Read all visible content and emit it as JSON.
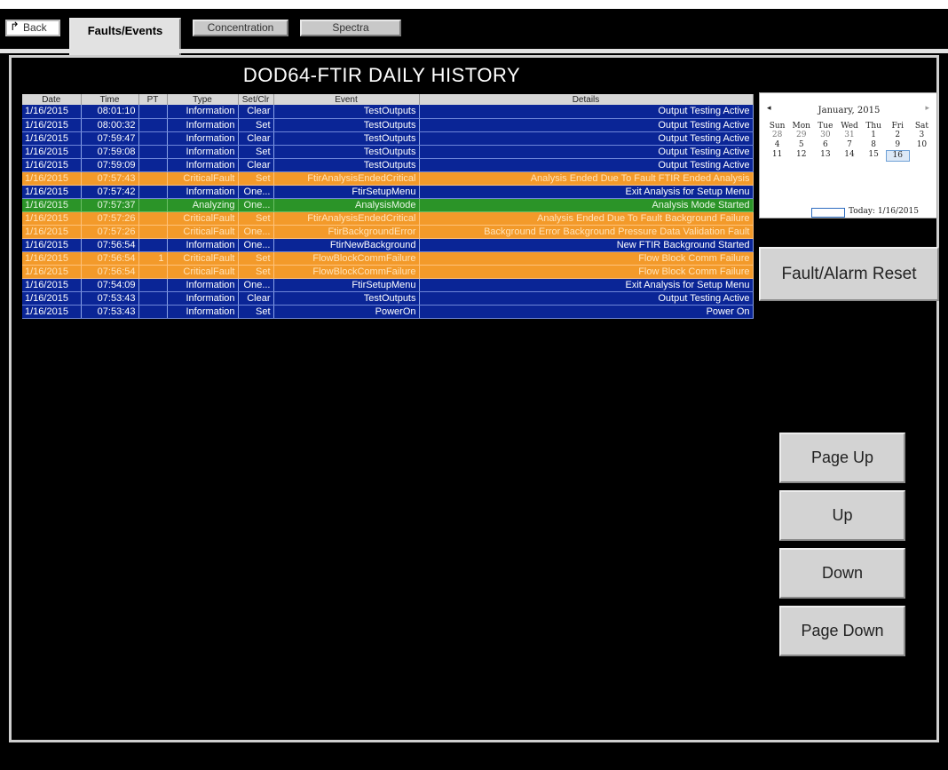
{
  "tabs": {
    "back": "Back",
    "faults": "Faults/Events",
    "concentration": "Concentration",
    "spectra": "Spectra"
  },
  "title": "DOD64-FTIR   DAILY HISTORY",
  "table": {
    "columns": [
      "Date",
      "Time",
      "PT",
      "Type",
      "Set/Clr",
      "Event",
      "Details"
    ],
    "rows": [
      {
        "kind": "info",
        "cells": [
          "1/16/2015",
          "08:01:10",
          "",
          "Information",
          "Clear",
          "TestOutputs",
          "Output Testing Active"
        ]
      },
      {
        "kind": "info",
        "cells": [
          "1/16/2015",
          "08:00:32",
          "",
          "Information",
          "Set",
          "TestOutputs",
          "Output Testing Active"
        ]
      },
      {
        "kind": "info",
        "cells": [
          "1/16/2015",
          "07:59:47",
          "",
          "Information",
          "Clear",
          "TestOutputs",
          "Output Testing Active"
        ]
      },
      {
        "kind": "info",
        "cells": [
          "1/16/2015",
          "07:59:08",
          "",
          "Information",
          "Set",
          "TestOutputs",
          "Output Testing Active"
        ]
      },
      {
        "kind": "info",
        "cells": [
          "1/16/2015",
          "07:59:09",
          "",
          "Information",
          "Clear",
          "TestOutputs",
          "Output Testing Active"
        ]
      },
      {
        "kind": "crit",
        "cells": [
          "1/16/2015",
          "07:57:43",
          "",
          "CriticalFault",
          "Set",
          "FtirAnalysisEndedCritical",
          "Analysis Ended Due To Fault FTIR Ended Analysis"
        ]
      },
      {
        "kind": "info",
        "cells": [
          "1/16/2015",
          "07:57:42",
          "",
          "Information",
          "One...",
          "FtirSetupMenu",
          "Exit Analysis for Setup Menu"
        ]
      },
      {
        "kind": "anal",
        "cells": [
          "1/16/2015",
          "07:57:37",
          "",
          "Analyzing",
          "One...",
          "AnalysisMode",
          "Analysis Mode  Started"
        ]
      },
      {
        "kind": "crit",
        "cells": [
          "1/16/2015",
          "07:57:26",
          "",
          "CriticalFault",
          "Set",
          "FtirAnalysisEndedCritical",
          "Analysis Ended Due To Fault Background Failure"
        ]
      },
      {
        "kind": "crit",
        "cells": [
          "1/16/2015",
          "07:57:26",
          "",
          "CriticalFault",
          "One...",
          "FtirBackgroundError",
          "Background Error  Background Pressure Data Validation Fault"
        ]
      },
      {
        "kind": "info",
        "cells": [
          "1/16/2015",
          "07:56:54",
          "",
          "Information",
          "One...",
          "FtirNewBackground",
          "New FTIR Background  Started"
        ]
      },
      {
        "kind": "crit",
        "cells": [
          "1/16/2015",
          "07:56:54",
          "1",
          "CriticalFault",
          "Set",
          "FlowBlockCommFailure",
          "Flow Block Comm Failure"
        ]
      },
      {
        "kind": "crit",
        "cells": [
          "1/16/2015",
          "07:56:54",
          "",
          "CriticalFault",
          "Set",
          "FlowBlockCommFailure",
          "Flow Block Comm Failure"
        ]
      },
      {
        "kind": "info",
        "cells": [
          "1/16/2015",
          "07:54:09",
          "",
          "Information",
          "One...",
          "FtirSetupMenu",
          "Exit Analysis for Setup Menu"
        ]
      },
      {
        "kind": "info",
        "cells": [
          "1/16/2015",
          "07:53:43",
          "",
          "Information",
          "Clear",
          "TestOutputs",
          "Output Testing Active"
        ]
      },
      {
        "kind": "info",
        "cells": [
          "1/16/2015",
          "07:53:43",
          "",
          "Information",
          "Set",
          "PowerOn",
          "Power On"
        ]
      }
    ]
  },
  "calendar": {
    "month": "January, 2015",
    "weekdays": [
      "Sun",
      "Mon",
      "Tue",
      "Wed",
      "Thu",
      "Fri",
      "Sat"
    ],
    "dates": [
      "28",
      "29",
      "30",
      "31",
      "1",
      "2",
      "3",
      "4",
      "5",
      "6",
      "7",
      "8",
      "9",
      "10",
      "11",
      "12",
      "13",
      "14",
      "15",
      "16"
    ],
    "other_month_count": 4,
    "selected": "16",
    "today_label": "Today: 1/16/2015"
  },
  "buttons": {
    "reset": "Fault/Alarm Reset",
    "page_up": "Page Up",
    "up": "Up",
    "down": "Down",
    "page_down": "Page Down"
  },
  "colors": {
    "info_row": "#0a2596",
    "critical_row": "#f39a2a",
    "analyzing_row": "#2b9428"
  }
}
